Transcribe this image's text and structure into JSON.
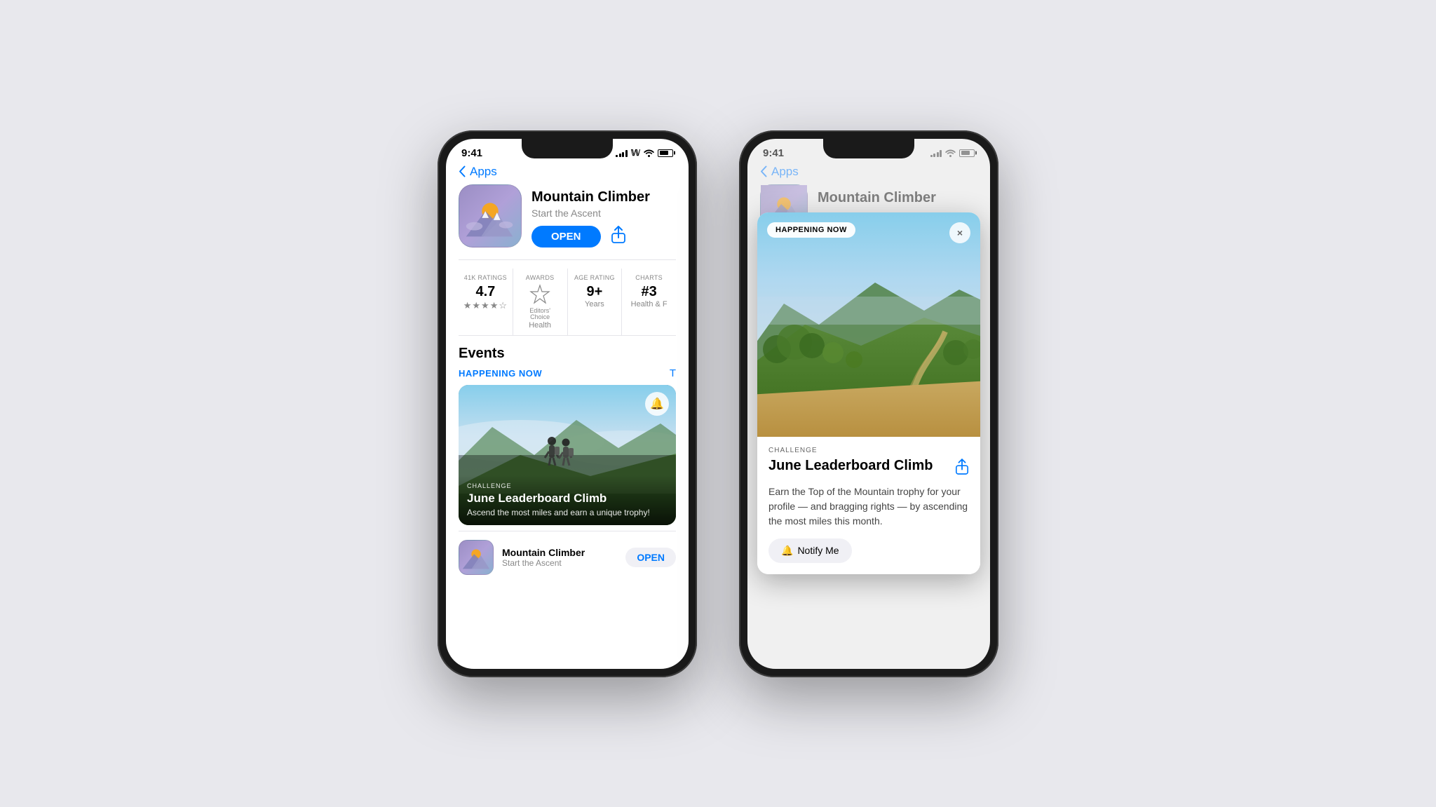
{
  "background_color": "#e8e8ed",
  "phone1": {
    "status_bar": {
      "time": "9:41",
      "signal": "signal",
      "wifi": "wifi",
      "battery": "battery"
    },
    "nav": {
      "back_label": "Apps"
    },
    "app": {
      "name": "Mountain Climber",
      "tagline": "Start the Ascent",
      "open_button": "OPEN",
      "stats": [
        {
          "label": "41K RATINGS",
          "value": "4.7",
          "sub": "★★★★☆"
        },
        {
          "label": "AWARDS",
          "value": "Editors'",
          "sub": "Choice",
          "category": "Health"
        },
        {
          "label": "AGE RATING",
          "value": "9+",
          "sub": "Years"
        },
        {
          "label": "CHARTS",
          "value": "#3",
          "sub": "Health & F"
        }
      ],
      "events_section": "Events",
      "happening_now_label": "HAPPENING NOW",
      "see_all": "T",
      "event": {
        "type": "CHALLENGE",
        "title": "June Leaderboard Climb",
        "description": "Ascend the most miles and earn a unique trophy!"
      },
      "bottom_row": {
        "name": "Mountain Climber",
        "tagline": "Start the Ascent",
        "open_button": "OPEN"
      }
    }
  },
  "phone2": {
    "status_bar": {
      "time": "9:41",
      "signal": "signal",
      "wifi": "wifi",
      "battery": "battery"
    },
    "nav": {
      "back_label": "Apps"
    },
    "modal": {
      "happening_now_tag": "HAPPENING NOW",
      "close_button": "×",
      "type": "CHALLENGE",
      "title": "June Leaderboard Climb",
      "share_icon": "share",
      "description": "Earn the Top of the Mountain trophy for your profile — and bragging rights — by ascending the most miles this month.",
      "notify_button": "Notify Me"
    },
    "bg_app": {
      "name": "Mountain Climber"
    }
  }
}
